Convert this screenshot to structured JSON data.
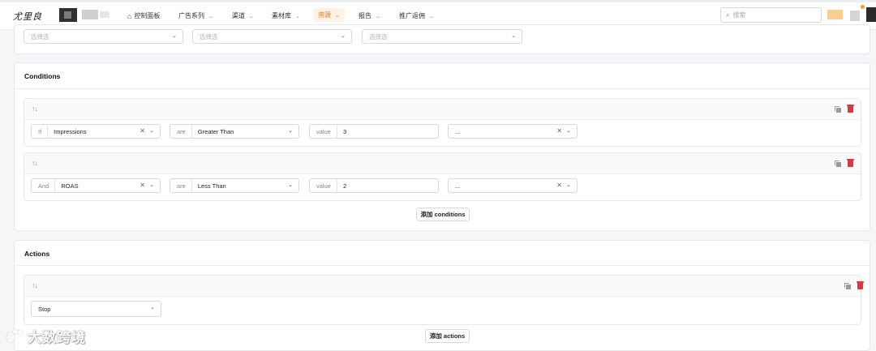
{
  "nav": {
    "logo": "尤里良",
    "items": [
      {
        "label": "控制面板",
        "has_icon": "home-icon"
      },
      {
        "label": "广告系列"
      },
      {
        "label": "渠道"
      },
      {
        "label": "素材库"
      },
      {
        "label": "资源",
        "active": true
      },
      {
        "label": "报告"
      },
      {
        "label": "推广返佣"
      }
    ],
    "search_placeholder": "搜索",
    "active_color": "#f07a12"
  },
  "filters": {
    "selects": [
      {
        "placeholder": "选择选"
      },
      {
        "placeholder": "选择选"
      },
      {
        "placeholder": "选择选"
      }
    ]
  },
  "conditions": {
    "title": "Conditions",
    "rules": [
      {
        "connector": "If",
        "metric": "Impressions",
        "operator_prefix": "are",
        "operator": "Greater Than",
        "value_prefix": "value",
        "value": "3",
        "extra": "..."
      },
      {
        "connector": "And",
        "metric": "ROAS",
        "operator_prefix": "are",
        "operator": "Less Than",
        "value_prefix": "value",
        "value": "2",
        "extra": "..."
      }
    ],
    "add_label": "添加 conditions"
  },
  "actions": {
    "title": "Actions",
    "action": "Stop",
    "add_label": "添加 actions"
  },
  "watermark": "大数跨境",
  "icons": {
    "sort": "↑↓",
    "chevron": "⌄",
    "clear": "✕",
    "search": "⌕",
    "home": "⌂"
  },
  "colors": {
    "delete": "#e0363b",
    "accent": "#f07a12"
  }
}
